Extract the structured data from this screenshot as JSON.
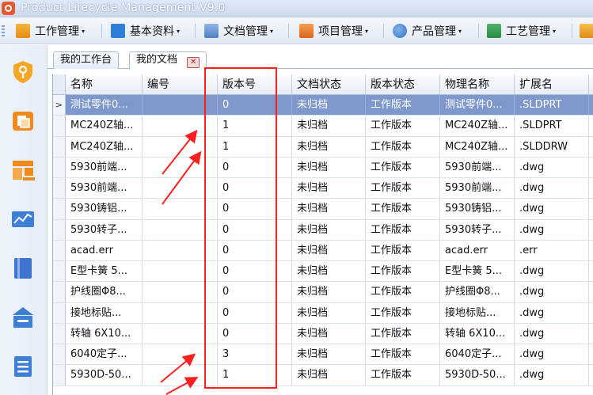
{
  "window": {
    "title": "Product Lifecycle Management V9.0"
  },
  "menu": {
    "items": [
      {
        "label": "工作管理",
        "icon": "work-management-icon"
      },
      {
        "label": "基本资料",
        "icon": "basic-data-icon"
      },
      {
        "label": "文档管理",
        "icon": "document-management-icon"
      },
      {
        "label": "项目管理",
        "icon": "project-management-icon"
      },
      {
        "label": "产品管理",
        "icon": "product-management-icon"
      },
      {
        "label": "工艺管理",
        "icon": "process-management-icon"
      }
    ],
    "caret": "▾"
  },
  "sidebar": {
    "icons": [
      "shield-key-icon",
      "document-exchange-icon",
      "stamp-icon",
      "trend-chart-icon",
      "book-icon",
      "mailbox-icon",
      "list-document-icon"
    ]
  },
  "tabs": [
    {
      "label": "我的工作台"
    },
    {
      "label": "我的文档",
      "close": "✕"
    }
  ],
  "table": {
    "columns": [
      "名称",
      "编号",
      "版本号",
      "文档状态",
      "版本状态",
      "物理名称",
      "扩展名"
    ],
    "rows": [
      [
        "测试零件0...",
        "",
        "0",
        "未归档",
        "工作版本",
        "测试零件0...",
        ".SLDPRT"
      ],
      [
        "MC240Z轴...",
        "",
        "1",
        "未归档",
        "工作版本",
        "MC240Z轴...",
        ".SLDPRT"
      ],
      [
        "MC240Z轴...",
        "",
        "1",
        "未归档",
        "工作版本",
        "MC240Z轴...",
        ".SLDDRW"
      ],
      [
        "5930前端...",
        "",
        "0",
        "未归档",
        "工作版本",
        "5930前端...",
        ".dwg"
      ],
      [
        "5930前端...",
        "",
        "0",
        "未归档",
        "工作版本",
        "5930前端...",
        ".dwg"
      ],
      [
        "5930铸铝...",
        "",
        "0",
        "未归档",
        "工作版本",
        "5930铸铝...",
        ".dwg"
      ],
      [
        "5930转子...",
        "",
        "0",
        "未归档",
        "工作版本",
        "5930转子...",
        ".dwg"
      ],
      [
        "acad.err",
        "",
        "0",
        "未归档",
        "工作版本",
        "acad.err",
        ".err"
      ],
      [
        "E型卡簧 5...",
        "",
        "0",
        "未归档",
        "工作版本",
        "E型卡簧 5...",
        ".dwg"
      ],
      [
        "护线圈Φ8...",
        "",
        "0",
        "未归档",
        "工作版本",
        "护线圈Φ8...",
        ".dwg"
      ],
      [
        "接地标贴...",
        "",
        "0",
        "未归档",
        "工作版本",
        "接地标贴...",
        ".dwg"
      ],
      [
        "转轴 6X10...",
        "",
        "0",
        "未归档",
        "工作版本",
        "转轴 6X10...",
        ".dwg"
      ],
      [
        "6040定子...",
        "",
        "3",
        "未归档",
        "工作版本",
        "6040定子...",
        ".dwg"
      ],
      [
        "5930D-50...",
        "",
        "1",
        "未归档",
        "工作版本",
        "5930D-50...",
        ".dwg"
      ]
    ],
    "selected_row_marker": ">"
  },
  "colors": {
    "selection": "#7f98cc",
    "highlight_annotation": "#ff1f1f"
  }
}
